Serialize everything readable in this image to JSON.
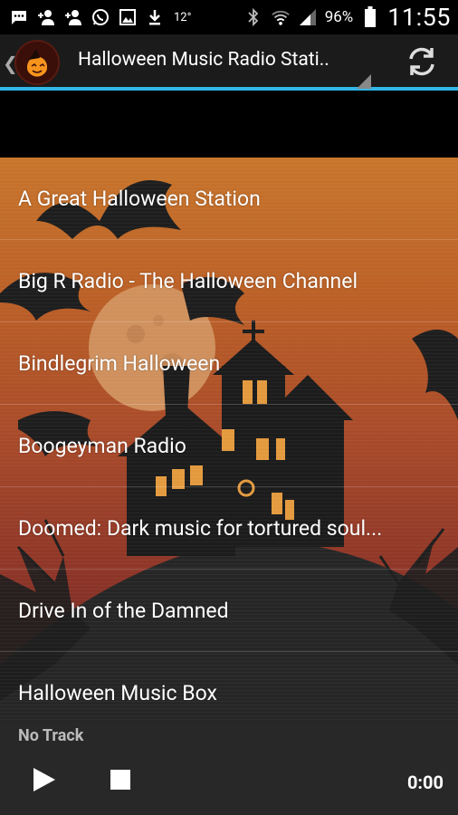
{
  "status_bar": {
    "left_icons": [
      "message-icon",
      "add-contact-icon",
      "add-contact-icon",
      "whatsapp-icon",
      "image-icon",
      "download-icon"
    ],
    "temperature": "12°",
    "battery_percent": "96%",
    "time": "11:55"
  },
  "action_bar": {
    "title": "Halloween Music Radio Stati..",
    "refresh_icon": "refresh-icon",
    "accent_color": "#33b5e5"
  },
  "stations": [
    {
      "label": "A Great Halloween Station"
    },
    {
      "label": "Big R Radio - The Halloween Channel"
    },
    {
      "label": "Bindlegrim Halloween"
    },
    {
      "label": "Boogeyman Radio"
    },
    {
      "label": "Doomed: Dark music for tortured soul..."
    },
    {
      "label": "Drive In of the Damned"
    },
    {
      "label": "Halloween Music Box"
    }
  ],
  "player": {
    "track": "No Track",
    "time": "0:00",
    "play_icon": "play-icon",
    "stop_icon": "stop-icon"
  }
}
